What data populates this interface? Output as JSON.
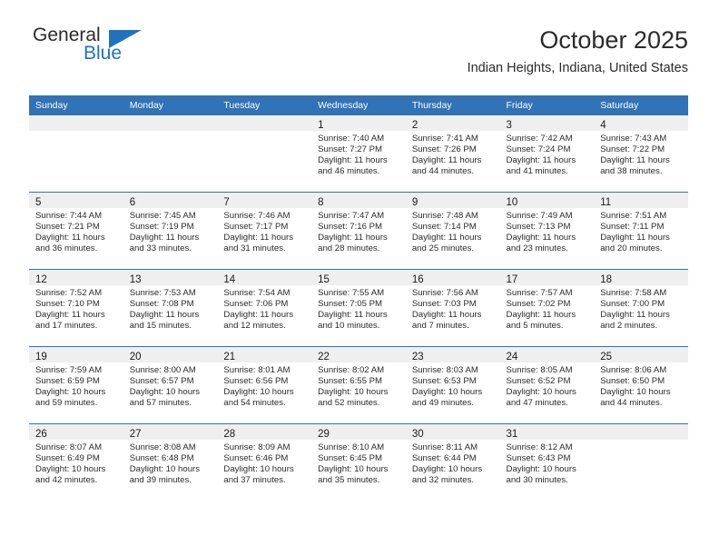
{
  "brand": {
    "name_top": "General",
    "name_bottom": "Blue",
    "logo_icon": "triangle-flag-icon",
    "color_primary": "#1f73bd",
    "color_text": "#2b2b2b"
  },
  "header": {
    "title": "October 2025",
    "subtitle": "Indian Heights, Indiana, United States"
  },
  "calendar": {
    "header_bg": "#3272b6",
    "daynum_band_bg": "#efefef",
    "row_divider_color": "#3272b6",
    "weekday_headers": [
      "Sunday",
      "Monday",
      "Tuesday",
      "Wednesday",
      "Thursday",
      "Friday",
      "Saturday"
    ],
    "weeks": [
      [
        {
          "day": "",
          "sunrise": "",
          "sunset": "",
          "daylight": "",
          "empty": true
        },
        {
          "day": "",
          "sunrise": "",
          "sunset": "",
          "daylight": "",
          "empty": true
        },
        {
          "day": "",
          "sunrise": "",
          "sunset": "",
          "daylight": "",
          "empty": true
        },
        {
          "day": "1",
          "sunrise": "Sunrise: 7:40 AM",
          "sunset": "Sunset: 7:27 PM",
          "daylight": "Daylight: 11 hours and 46 minutes."
        },
        {
          "day": "2",
          "sunrise": "Sunrise: 7:41 AM",
          "sunset": "Sunset: 7:26 PM",
          "daylight": "Daylight: 11 hours and 44 minutes."
        },
        {
          "day": "3",
          "sunrise": "Sunrise: 7:42 AM",
          "sunset": "Sunset: 7:24 PM",
          "daylight": "Daylight: 11 hours and 41 minutes."
        },
        {
          "day": "4",
          "sunrise": "Sunrise: 7:43 AM",
          "sunset": "Sunset: 7:22 PM",
          "daylight": "Daylight: 11 hours and 38 minutes."
        }
      ],
      [
        {
          "day": "5",
          "sunrise": "Sunrise: 7:44 AM",
          "sunset": "Sunset: 7:21 PM",
          "daylight": "Daylight: 11 hours and 36 minutes."
        },
        {
          "day": "6",
          "sunrise": "Sunrise: 7:45 AM",
          "sunset": "Sunset: 7:19 PM",
          "daylight": "Daylight: 11 hours and 33 minutes."
        },
        {
          "day": "7",
          "sunrise": "Sunrise: 7:46 AM",
          "sunset": "Sunset: 7:17 PM",
          "daylight": "Daylight: 11 hours and 31 minutes."
        },
        {
          "day": "8",
          "sunrise": "Sunrise: 7:47 AM",
          "sunset": "Sunset: 7:16 PM",
          "daylight": "Daylight: 11 hours and 28 minutes."
        },
        {
          "day": "9",
          "sunrise": "Sunrise: 7:48 AM",
          "sunset": "Sunset: 7:14 PM",
          "daylight": "Daylight: 11 hours and 25 minutes."
        },
        {
          "day": "10",
          "sunrise": "Sunrise: 7:49 AM",
          "sunset": "Sunset: 7:13 PM",
          "daylight": "Daylight: 11 hours and 23 minutes."
        },
        {
          "day": "11",
          "sunrise": "Sunrise: 7:51 AM",
          "sunset": "Sunset: 7:11 PM",
          "daylight": "Daylight: 11 hours and 20 minutes."
        }
      ],
      [
        {
          "day": "12",
          "sunrise": "Sunrise: 7:52 AM",
          "sunset": "Sunset: 7:10 PM",
          "daylight": "Daylight: 11 hours and 17 minutes."
        },
        {
          "day": "13",
          "sunrise": "Sunrise: 7:53 AM",
          "sunset": "Sunset: 7:08 PM",
          "daylight": "Daylight: 11 hours and 15 minutes."
        },
        {
          "day": "14",
          "sunrise": "Sunrise: 7:54 AM",
          "sunset": "Sunset: 7:06 PM",
          "daylight": "Daylight: 11 hours and 12 minutes."
        },
        {
          "day": "15",
          "sunrise": "Sunrise: 7:55 AM",
          "sunset": "Sunset: 7:05 PM",
          "daylight": "Daylight: 11 hours and 10 minutes."
        },
        {
          "day": "16",
          "sunrise": "Sunrise: 7:56 AM",
          "sunset": "Sunset: 7:03 PM",
          "daylight": "Daylight: 11 hours and 7 minutes."
        },
        {
          "day": "17",
          "sunrise": "Sunrise: 7:57 AM",
          "sunset": "Sunset: 7:02 PM",
          "daylight": "Daylight: 11 hours and 5 minutes."
        },
        {
          "day": "18",
          "sunrise": "Sunrise: 7:58 AM",
          "sunset": "Sunset: 7:00 PM",
          "daylight": "Daylight: 11 hours and 2 minutes."
        }
      ],
      [
        {
          "day": "19",
          "sunrise": "Sunrise: 7:59 AM",
          "sunset": "Sunset: 6:59 PM",
          "daylight": "Daylight: 10 hours and 59 minutes."
        },
        {
          "day": "20",
          "sunrise": "Sunrise: 8:00 AM",
          "sunset": "Sunset: 6:57 PM",
          "daylight": "Daylight: 10 hours and 57 minutes."
        },
        {
          "day": "21",
          "sunrise": "Sunrise: 8:01 AM",
          "sunset": "Sunset: 6:56 PM",
          "daylight": "Daylight: 10 hours and 54 minutes."
        },
        {
          "day": "22",
          "sunrise": "Sunrise: 8:02 AM",
          "sunset": "Sunset: 6:55 PM",
          "daylight": "Daylight: 10 hours and 52 minutes."
        },
        {
          "day": "23",
          "sunrise": "Sunrise: 8:03 AM",
          "sunset": "Sunset: 6:53 PM",
          "daylight": "Daylight: 10 hours and 49 minutes."
        },
        {
          "day": "24",
          "sunrise": "Sunrise: 8:05 AM",
          "sunset": "Sunset: 6:52 PM",
          "daylight": "Daylight: 10 hours and 47 minutes."
        },
        {
          "day": "25",
          "sunrise": "Sunrise: 8:06 AM",
          "sunset": "Sunset: 6:50 PM",
          "daylight": "Daylight: 10 hours and 44 minutes."
        }
      ],
      [
        {
          "day": "26",
          "sunrise": "Sunrise: 8:07 AM",
          "sunset": "Sunset: 6:49 PM",
          "daylight": "Daylight: 10 hours and 42 minutes."
        },
        {
          "day": "27",
          "sunrise": "Sunrise: 8:08 AM",
          "sunset": "Sunset: 6:48 PM",
          "daylight": "Daylight: 10 hours and 39 minutes."
        },
        {
          "day": "28",
          "sunrise": "Sunrise: 8:09 AM",
          "sunset": "Sunset: 6:46 PM",
          "daylight": "Daylight: 10 hours and 37 minutes."
        },
        {
          "day": "29",
          "sunrise": "Sunrise: 8:10 AM",
          "sunset": "Sunset: 6:45 PM",
          "daylight": "Daylight: 10 hours and 35 minutes."
        },
        {
          "day": "30",
          "sunrise": "Sunrise: 8:11 AM",
          "sunset": "Sunset: 6:44 PM",
          "daylight": "Daylight: 10 hours and 32 minutes."
        },
        {
          "day": "31",
          "sunrise": "Sunrise: 8:12 AM",
          "sunset": "Sunset: 6:43 PM",
          "daylight": "Daylight: 10 hours and 30 minutes."
        },
        {
          "day": "",
          "sunrise": "",
          "sunset": "",
          "daylight": "",
          "empty": true
        }
      ]
    ]
  }
}
